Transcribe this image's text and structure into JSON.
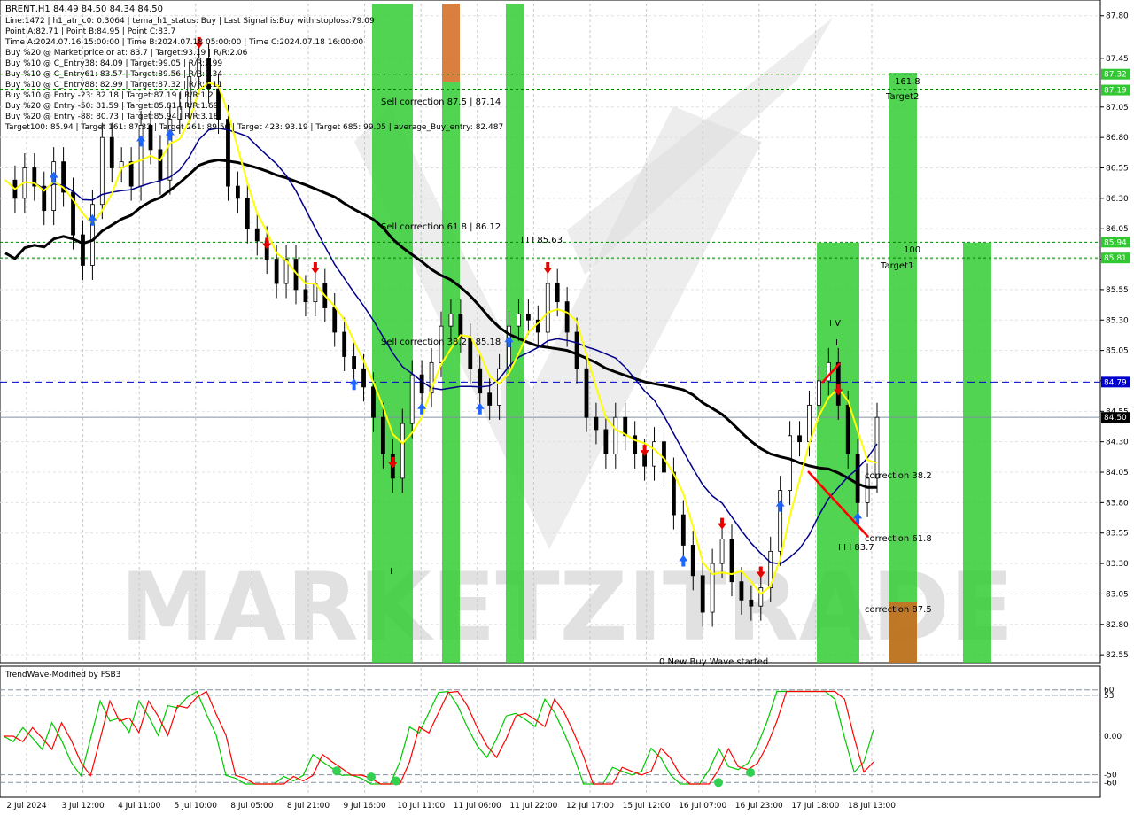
{
  "header": {
    "title": "BRENT,H1  84.49 84.50 84.34 84.50",
    "lines": [
      "Line:1472  |  h1_atr_c0: 0.3064  |  tema_h1_status: Buy  |  Last Signal is:Buy with stoploss:79.09",
      "Point A:82.71  |  Point B:84.95  |  Point C:83.7",
      "Time A:2024.07.16 15:00:00  |  Time B:2024.07.18 05:00:00  |  Time C:2024.07.18 16:00:00",
      "Buy %20 @ Market price or at: 83.7  |  Target:93.19  |  R/R:2.06",
      "Buy %10 @ C_Entry38: 84.09  |  Target:99.05  |  R/R:2.99",
      "Buy %10 @ C_Entry61: 83.57  |  Target:89.56  |  R/R:1.34",
      "Buy %10 @ C_Entry88: 82.99  |  Target:87.32  |  R/R:1.11",
      "Buy %10 @ Entry -23: 82.18  |  Target:87.19  |  R/R:1.2",
      "Buy %20 @ Entry -50: 81.59  |  Target:85.81  |  R/R:1.69",
      "Buy %20 @ Entry -88: 80.73  |  Target:85.94  |  R/R:3.18",
      "Target100: 85.94  |  Target 161: 87.32  |  Target 261: 89.56  |  Target 423: 93.19  |  Target 685: 99.05  |  average_Buy_entry: 82.487"
    ]
  },
  "annotations": {
    "sell_875": "Sell correction 87.5 | 87.14",
    "sell_618": "Sell correction 61.8 | 86.12",
    "sell_382": "Sell correction 38.2 | 85.18",
    "wave_iii": "I I I 85.63",
    "wave_iv": "I V",
    "wave_iv_sub": "I",
    "target2_num": "161.8",
    "target2": "Target2",
    "target1_num": "100",
    "target1": "Target1",
    "corr_382": "correction 38.2",
    "corr_618": "correction 61.8",
    "corr_875": "correction 87.5",
    "point_iii": "I I I 83.7",
    "new_wave": "0 New Buy Wave started",
    "wave_i": "I"
  },
  "watermark": "MARKETZITRADE",
  "indicator": {
    "title": "TrendWave-Modified by FSB3"
  },
  "colors": {
    "price_line": "#000000",
    "ma_blue": "#00008b",
    "ma_black": "#000000",
    "yellow": "#ffff00",
    "buy_zone": "#32cd32",
    "sell_zone": "#d2691e",
    "level_tag": "#32c832",
    "current_price_tag": "#000000",
    "blue_level_tag": "#0000cd",
    "osc_green": "#00c800",
    "osc_red": "#ff0000"
  },
  "chart_data": {
    "type": "line",
    "title": "BRENT,H1",
    "y_ticks": [
      "87.80",
      "87.45",
      "87.05",
      "86.80",
      "86.55",
      "86.30",
      "86.05",
      "85.80",
      "85.55",
      "85.30",
      "85.05",
      "84.80",
      "84.55",
      "84.30",
      "84.05",
      "83.80",
      "83.55",
      "83.30",
      "83.05",
      "82.80",
      "82.55"
    ],
    "x_ticks": [
      "2 Jul 2024",
      "3 Jul 12:00",
      "4 Jul 11:00",
      "5 Jul 10:00",
      "8 Jul 05:00",
      "8 Jul 21:00",
      "9 Jul 16:00",
      "10 Jul 11:00",
      "11 Jul 06:00",
      "11 Jul 22:00",
      "12 Jul 17:00",
      "15 Jul 12:00",
      "16 Jul 07:00",
      "16 Jul 23:00",
      "17 Jul 18:00",
      "18 Jul 13:00"
    ],
    "ylim": [
      82.5,
      87.9
    ],
    "price_tags": [
      {
        "label": "87.32",
        "value": 87.32,
        "kind": "green"
      },
      {
        "label": "87.19",
        "value": 87.19,
        "kind": "green"
      },
      {
        "label": "85.94",
        "value": 85.94,
        "kind": "green"
      },
      {
        "label": "85.81",
        "value": 85.81,
        "kind": "green"
      },
      {
        "label": "84.79",
        "value": 84.79,
        "kind": "blue"
      },
      {
        "label": "84.50",
        "value": 84.5,
        "kind": "current"
      }
    ],
    "series": [
      {
        "name": "close",
        "values": [
          86.45,
          86.3,
          86.55,
          86.4,
          86.2,
          86.6,
          86.35,
          86.0,
          85.75,
          86.25,
          86.8,
          86.55,
          86.6,
          86.4,
          86.9,
          86.7,
          86.45,
          86.95,
          87.05,
          87.3,
          87.45,
          87.2,
          86.95,
          86.4,
          86.3,
          86.05,
          85.95,
          85.8,
          85.6,
          85.8,
          85.55,
          85.45,
          85.6,
          85.4,
          85.2,
          85.0,
          84.9,
          84.75,
          84.5,
          84.2,
          84.0,
          84.45,
          84.85,
          84.7,
          84.95,
          85.25,
          85.35,
          85.15,
          84.9,
          84.7,
          84.6,
          84.9,
          85.25,
          85.35,
          85.3,
          85.2,
          85.6,
          85.45,
          85.2,
          84.9,
          84.5,
          84.4,
          84.2,
          84.5,
          84.35,
          84.2,
          84.1,
          84.3,
          84.05,
          83.7,
          83.45,
          83.2,
          82.9,
          83.3,
          83.5,
          83.15,
          83.0,
          82.95,
          83.1,
          83.4,
          83.9,
          84.35,
          84.3,
          84.6,
          84.8,
          84.95,
          84.6,
          84.2,
          83.8,
          84.0,
          84.5
        ]
      }
    ]
  }
}
